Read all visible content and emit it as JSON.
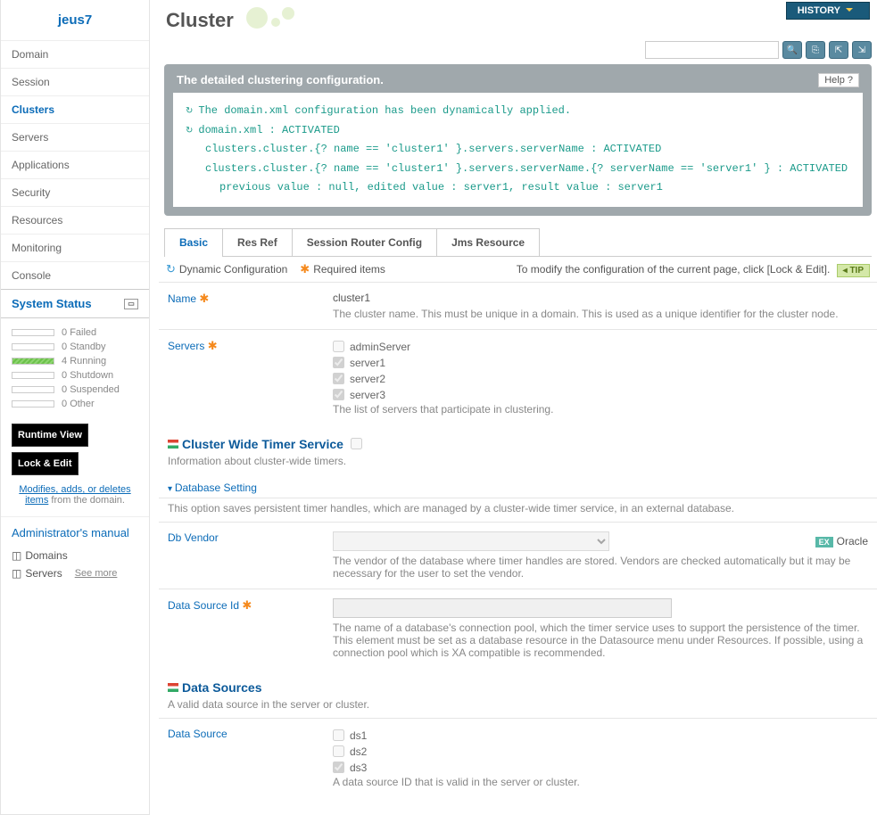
{
  "logo": "jeus7",
  "history_label": "HISTORY",
  "nav": [
    {
      "label": "Domain",
      "active": false
    },
    {
      "label": "Session",
      "active": false
    },
    {
      "label": "Clusters",
      "active": true
    },
    {
      "label": "Servers",
      "active": false
    },
    {
      "label": "Applications",
      "active": false
    },
    {
      "label": "Security",
      "active": false
    },
    {
      "label": "Resources",
      "active": false
    },
    {
      "label": "Monitoring",
      "active": false
    },
    {
      "label": "Console",
      "active": false
    }
  ],
  "system_status_header": "System Status",
  "status": [
    {
      "count": "0",
      "label": "Failed",
      "filled": false
    },
    {
      "count": "0",
      "label": "Standby",
      "filled": false
    },
    {
      "count": "4",
      "label": "Running",
      "filled": true
    },
    {
      "count": "0",
      "label": "Shutdown",
      "filled": false
    },
    {
      "count": "0",
      "label": "Suspended",
      "filled": false
    },
    {
      "count": "0",
      "label": "Other",
      "filled": false
    }
  ],
  "buttons": {
    "runtime": "Runtime View",
    "lock": "Lock & Edit"
  },
  "sidebar_desc_link": "Modifies, adds, or deletes items",
  "sidebar_desc_rest": " from the domain.",
  "manual": {
    "title": "Administrator's manual",
    "items": [
      "Domains",
      "Servers"
    ],
    "see_more": "See more"
  },
  "page_title": "Cluster",
  "panel_title": "The detailed clustering configuration.",
  "help_label": "Help ?",
  "config_lines": {
    "l1": "The domain.xml configuration has been dynamically applied.",
    "l2": "domain.xml : ACTIVATED",
    "l3": "clusters.cluster.{? name == 'cluster1' }.servers.serverName : ACTIVATED",
    "l4": "clusters.cluster.{? name == 'cluster1' }.servers.serverName.{? serverName == 'server1' } : ACTIVATED",
    "l5": "previous value : null, edited value : server1, result value : server1"
  },
  "tabs": [
    {
      "label": "Basic",
      "active": true
    },
    {
      "label": "Res Ref",
      "active": false
    },
    {
      "label": "Session Router Config",
      "active": false
    },
    {
      "label": "Jms Resource",
      "active": false
    }
  ],
  "legend": {
    "dynamic": "Dynamic Configuration",
    "required": "Required items",
    "tip_text": "To modify the configuration of the current page, click [Lock & Edit].",
    "tip_badge": "TIP"
  },
  "form": {
    "name": {
      "label": "Name",
      "value": "cluster1",
      "desc": "The cluster name. This must be unique in a domain. This is used as a unique identifier for the cluster node."
    },
    "servers": {
      "label": "Servers",
      "items": [
        {
          "label": "adminServer",
          "checked": false
        },
        {
          "label": "server1",
          "checked": true
        },
        {
          "label": "server2",
          "checked": true
        },
        {
          "label": "server3",
          "checked": true
        }
      ],
      "desc": "The list of servers that participate in clustering."
    }
  },
  "timer": {
    "title": "Cluster Wide Timer Service",
    "desc": "Information about cluster-wide timers.",
    "db_setting": "Database Setting",
    "db_setting_desc": "This option saves persistent timer handles, which are managed by a cluster-wide timer service, in an external database.",
    "vendor_label": "Db Vendor",
    "vendor_ex": "Oracle",
    "vendor_desc": "The vendor of the database where timer handles are stored. Vendors are checked automatically but it may be necessary for the user to set the vendor.",
    "dsid_label": "Data Source Id",
    "dsid_desc": "The name of a database's connection pool, which the timer service uses to support the persistence of the timer. This element must be set as a database resource in the Datasource menu under Resources. If possible, using a connection pool which is XA compatible is recommended."
  },
  "datasources": {
    "title": "Data Sources",
    "desc": "A valid data source in the server or cluster.",
    "label": "Data Source",
    "items": [
      {
        "label": "ds1",
        "checked": false
      },
      {
        "label": "ds2",
        "checked": false
      },
      {
        "label": "ds3",
        "checked": true
      }
    ],
    "item_desc": "A data source ID that is valid in the server or cluster."
  }
}
